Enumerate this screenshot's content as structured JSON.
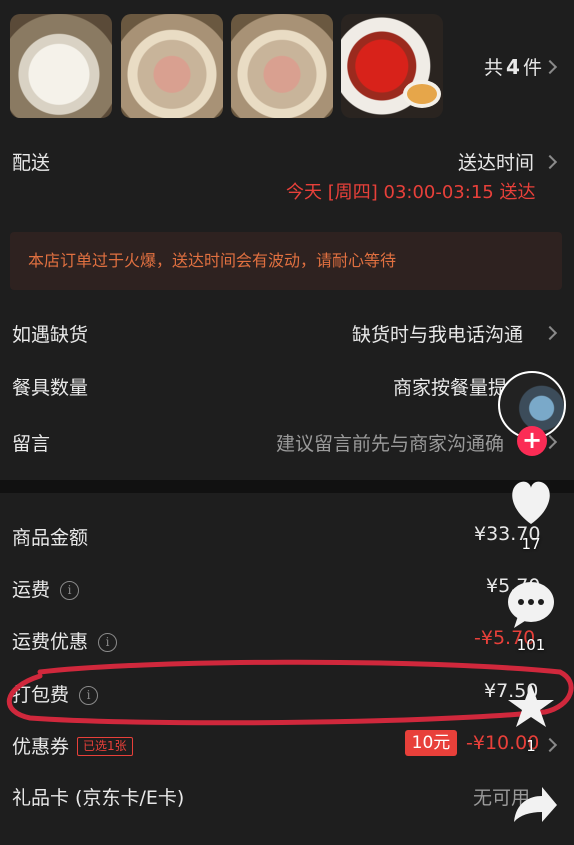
{
  "order": {
    "count_prefix": "共",
    "count_value": "4",
    "count_suffix": "件"
  },
  "delivery": {
    "label": "配送",
    "time_label": "送达时间",
    "time_value": "今天 [周四] 03:00-03:15 送达"
  },
  "notice": "本店订单过于火爆，送达时间会有波动，请耐心等待",
  "options": [
    {
      "label": "如遇缺货",
      "value": "缺货时与我电话沟通"
    },
    {
      "label": "餐具数量",
      "value": "商家按餐量提"
    },
    {
      "label": "留言",
      "value": "建议留言前先与商家沟通确"
    }
  ],
  "fees": {
    "goods_label": "商品金额",
    "goods_value": "¥33.70",
    "shipping_label": "运费",
    "shipping_value": "¥5.70",
    "shipping_discount_label": "运费优惠",
    "shipping_discount_value": "-¥5.70",
    "packing_label": "打包费",
    "packing_value": "¥7.50",
    "coupon_label": "优惠券",
    "coupon_tag": "已选1张",
    "coupon_badge": "10元",
    "coupon_value": "-¥10.00",
    "giftcard_label": "礼品卡 (京东卡/E卡)",
    "giftcard_value": "无可用"
  },
  "side": {
    "likes": "17",
    "comments": "101",
    "favorites": "1"
  },
  "info_glyph": "i",
  "plus_glyph": "+",
  "colors": {
    "accent_red": "#e8403a",
    "notice_text": "#e07040",
    "background": "#1e1e1e",
    "annotation": "#d0283c"
  }
}
